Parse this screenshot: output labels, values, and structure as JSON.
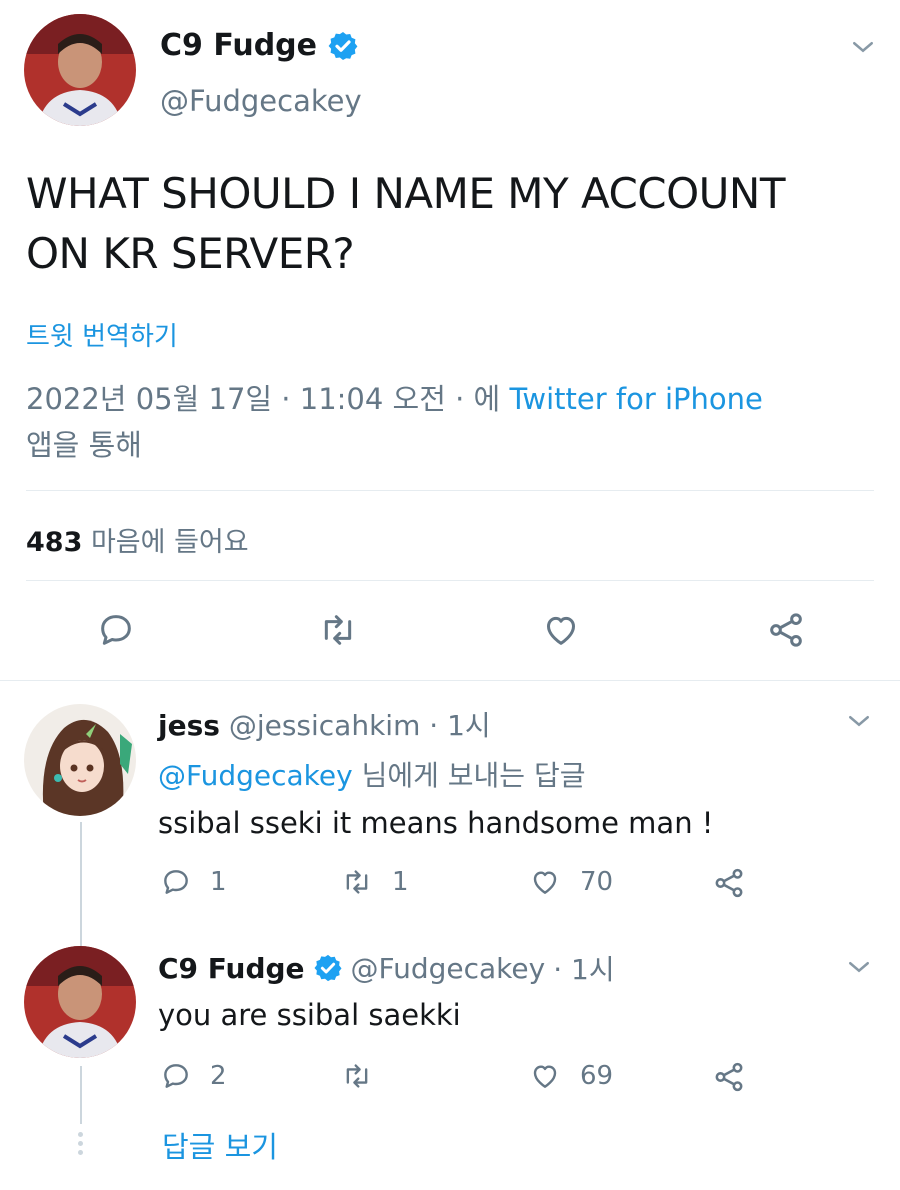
{
  "main_tweet": {
    "display_name": "C9 Fudge",
    "handle": "@Fudgecakey",
    "text_line1": "WHAT SHOULD I NAME MY ACCOUNT",
    "text_line2": "ON KR SERVER?",
    "translate_label": "트윗 번역하기",
    "timestamp": "2022년 05월 17일 · 11:04 오전 · 에",
    "source": "Twitter for iPhone",
    "source_suffix": "앱을 통해",
    "likes_count": "483",
    "likes_label": "마음에 들어요"
  },
  "reply1": {
    "display_name": "jess",
    "handle": "@jessicahkim",
    "time": "· 1시",
    "reply_to_handle": "@Fudgecakey",
    "reply_to_suffix": "님에게 보내는 답글",
    "text": "ssibal sseki it means handsome man !",
    "replies": "1",
    "retweets": "1",
    "likes": "70"
  },
  "reply2": {
    "display_name": "C9 Fudge",
    "handle": "@Fudgecakey",
    "time": "· 1시",
    "text": "you are ssibal saekki",
    "replies": "2",
    "retweets": "",
    "likes": "69"
  },
  "show_replies_label": "답글 보기",
  "colors": {
    "accent": "#1b95e0",
    "text": "#14171a",
    "secondary": "#657786",
    "verified": "#1da1f2"
  },
  "icons": [
    "chevron-down-icon",
    "verified-badge-icon",
    "reply-icon",
    "retweet-icon",
    "heart-icon",
    "share-icon"
  ]
}
